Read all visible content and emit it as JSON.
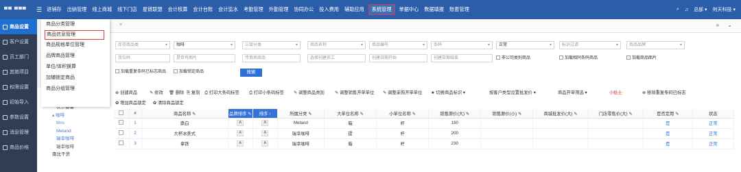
{
  "app": {
    "logo_text": "▀▀ ▀▀▀",
    "menu_icon": "☰"
  },
  "nav": {
    "items": [
      "进销存",
      "出纳管理",
      "线上商城",
      "线下门店",
      "星链联盟",
      "会计核算",
      "会计台账",
      "会计监水",
      "考勤管理",
      "外勤管理",
      "协同办公",
      "投入费用",
      "辅助应用",
      "系统管理",
      "单据中心",
      "数据填报",
      "账套管理"
    ],
    "active_index": 13
  },
  "topright": {
    "search_icon": "⌕",
    "bell_icon": "♫",
    "user": "总部",
    "company": "何天科技"
  },
  "sidebar": {
    "items": [
      "商品设置",
      "客户设置",
      "员工部门",
      "其她项目",
      "权限设置",
      "初始导入",
      "参数设置",
      "消息管理",
      "商品价格"
    ],
    "active_index": 0
  },
  "submenu": {
    "items": [
      "商品分类管理",
      "商品信息管理",
      "商品规格单位管理",
      "品牌商品管理",
      "单位/体积换算",
      "加辅锁定商品",
      "商品分组管理"
    ],
    "highlighted_index": 1
  },
  "tree": {
    "items": [
      {
        "label": "▸ 购物",
        "level": 1
      },
      {
        "label": "哇哈哈",
        "level": 2
      },
      {
        "label": "快乐番薯",
        "level": 2
      },
      {
        "label": "▴ 咖啡",
        "level": 1,
        "blue": true
      },
      {
        "label": "tims",
        "level": 2,
        "blue": true
      },
      {
        "label": "Metand",
        "level": 2,
        "blue": true
      },
      {
        "label": "瑞幸咖啡",
        "level": 2,
        "blue": true
      },
      {
        "label": "瑞幸咖啡",
        "level": 2
      },
      {
        "label": "南北干货",
        "level": 1
      }
    ]
  },
  "tabbar": {
    "close_icon": "×",
    "scroll_icons": "» ⌄"
  },
  "filters": {
    "row1": [
      "库存商品类",
      "咖啡",
      "三级分类",
      "商品名称",
      "商品编号",
      "条码",
      "正常",
      "标识过滤",
      "商品品牌"
    ],
    "row2": [
      "货位码",
      "是否有图片",
      "传真商商品",
      "选择创建员工",
      "创建日期开始",
      "创建日期结束"
    ],
    "checks_row2": [
      "非公司类别商品",
      "加载相同条码商品",
      "加载商品图片"
    ],
    "checks_row3": [
      "加载重复条码已标志商品",
      "加载锁定商品"
    ],
    "search_button": "搜索"
  },
  "toolbar": {
    "items": [
      "⊕ 创建商品",
      "✎ 修改",
      "🗑 删除",
      "⎘ 复制",
      "⎙ 打印大条码标签",
      "⎙ 打印小条码标签",
      "✎ 调整商品类别",
      "✎ 调整销售开单单位",
      "✎ 调整采购开单单位",
      "★ 切换商品标识 ▾",
      "按客户类型设置批发价 ▾",
      "商品开单筛选 ▾",
      "小贴士",
      "⊗ 移除重复条码已标志"
    ],
    "row2": [
      "✿ 增加商品锁定",
      "✿ 清除商品锁定"
    ]
  },
  "table": {
    "headers": [
      "",
      "#",
      "商品名称 ✎",
      "品牌排序 ✎",
      "排序 ↑",
      "所属分类 ✎",
      "大单位名称 ✎",
      "小单位名称 ✎",
      "销售原价(大) ✎",
      "销售原价(小) ✎",
      "商城批发价(大) ✎",
      "门店零售价(大) ✎",
      "是否定用 ✎",
      "状态"
    ],
    "rows": [
      {
        "num": "1",
        "name": "撕白",
        "sort1": "A",
        "sort2": "A",
        "category": "Metand",
        "big_unit": "箱",
        "small_unit": "杆",
        "price_big": "190",
        "price_small": "",
        "mall_price": "",
        "store_price": "",
        "enabled": "是",
        "status": "正常"
      },
      {
        "num": "2",
        "name": "大杯冰美式",
        "sort1": "A",
        "sort2": "A",
        "category": "瑞幸咖啡",
        "big_unit": "提",
        "small_unit": "杆",
        "price_big": "200",
        "price_small": "",
        "mall_price": "",
        "store_price": "",
        "enabled": "是",
        "status": "正常"
      },
      {
        "num": "3",
        "name": "拿铁",
        "sort1": "A",
        "sort2": "A",
        "category": "瑞幸咖啡",
        "big_unit": "箱",
        "small_unit": "杆",
        "price_big": "230",
        "price_small": "",
        "mall_price": "",
        "store_price": "",
        "enabled": "是",
        "status": "正常"
      }
    ]
  },
  "colors": {
    "topbar": "#2a5ea8",
    "sidebar": "#2f3e55",
    "accent": "#2e6fd6",
    "highlight_border": "#e03a3a"
  }
}
